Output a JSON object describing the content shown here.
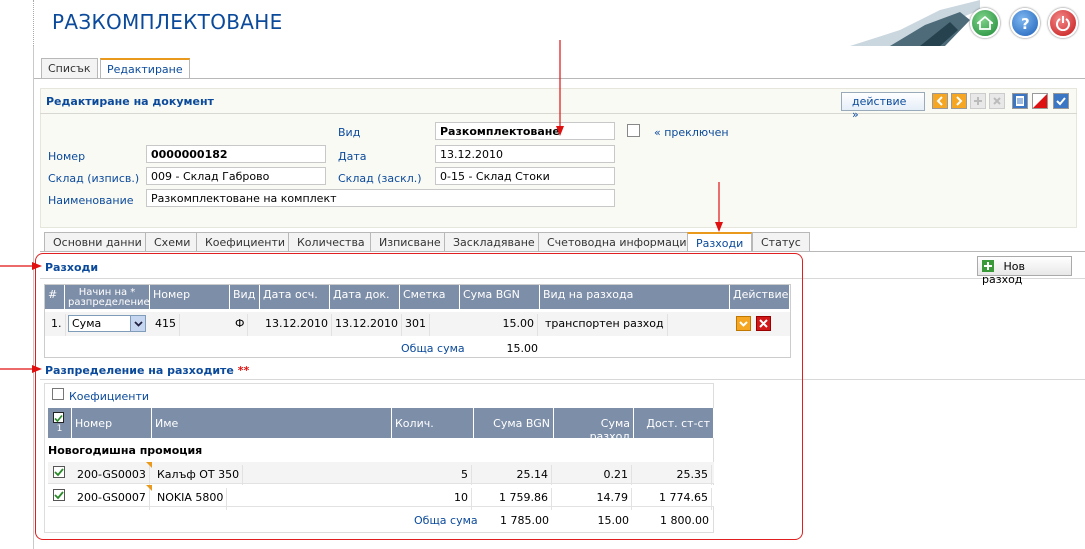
{
  "header": {
    "title": "РАЗКОМПЛЕКТОВАНЕ"
  },
  "tabs": [
    {
      "label": "Списък"
    },
    {
      "label": "Редактиране"
    }
  ],
  "doc": {
    "title": "Редактиране на документ",
    "action_label": "действие »",
    "vid_label": "Вид",
    "vid_value": "Разкомплектоване",
    "switched_label": "« преключен",
    "nomer_label": "Номер",
    "nomer_value": "0000000182",
    "data_label": "Дата",
    "data_value": "13.12.2010",
    "sklad_out_label": "Склад (изписв.)",
    "sklad_out_value": "009 - Склад Габрово",
    "sklad_in_label": "Склад (заскл.)",
    "sklad_in_value": "0-15 - Склад Стоки",
    "name_label": "Наименование",
    "name_value": "Разкомплектоване на комплект"
  },
  "subtabs": [
    "Основни данни",
    "Схеми",
    "Коефициенти",
    "Количества",
    "Изписване",
    "Заскладяване",
    "Счетоводна информация",
    "Разходи",
    "Статус"
  ],
  "expenses": {
    "title": "Разходи",
    "new_button": "Нов разход",
    "headers": [
      "#",
      "Начин на * разпределение",
      "Номер",
      "Вид",
      "Дата осч.",
      "Дата док.",
      "Сметка",
      "Сума BGN",
      "Вид на разхода",
      "Действие"
    ],
    "rows": [
      {
        "num": "1.",
        "method": "Сума",
        "number": "415",
        "type": "Ф",
        "date_acc": "13.12.2010",
        "date_doc": "13.12.2010",
        "account": "301",
        "sum": "15.00",
        "kind": "транспортен разход"
      }
    ],
    "total_label": "Обща сума",
    "total_value": "15.00"
  },
  "distribution": {
    "title": "Разпределение на разходите",
    "stars": "**",
    "coef_label": "Коефициенти",
    "check_count": "1",
    "headers": [
      "Номер",
      "Име",
      "Колич.",
      "Сума BGN",
      "Сума разход",
      "Дост. ст-ст"
    ],
    "group": "Новогодишна промоция",
    "rows": [
      {
        "number": "200-GS0003",
        "name": "Калъф ОТ 350",
        "qty": "5",
        "sum": "25.14",
        "exp": "0.21",
        "cost": "25.35"
      },
      {
        "number": "200-GS0007",
        "name": "NOKIA 5800",
        "qty": "10",
        "sum": "1 759.86",
        "exp": "14.79",
        "cost": "1 774.65"
      }
    ],
    "total_label": "Обща сума",
    "total_sum": "1 785.00",
    "total_exp": "15.00",
    "total_cost": "1 800.00"
  }
}
